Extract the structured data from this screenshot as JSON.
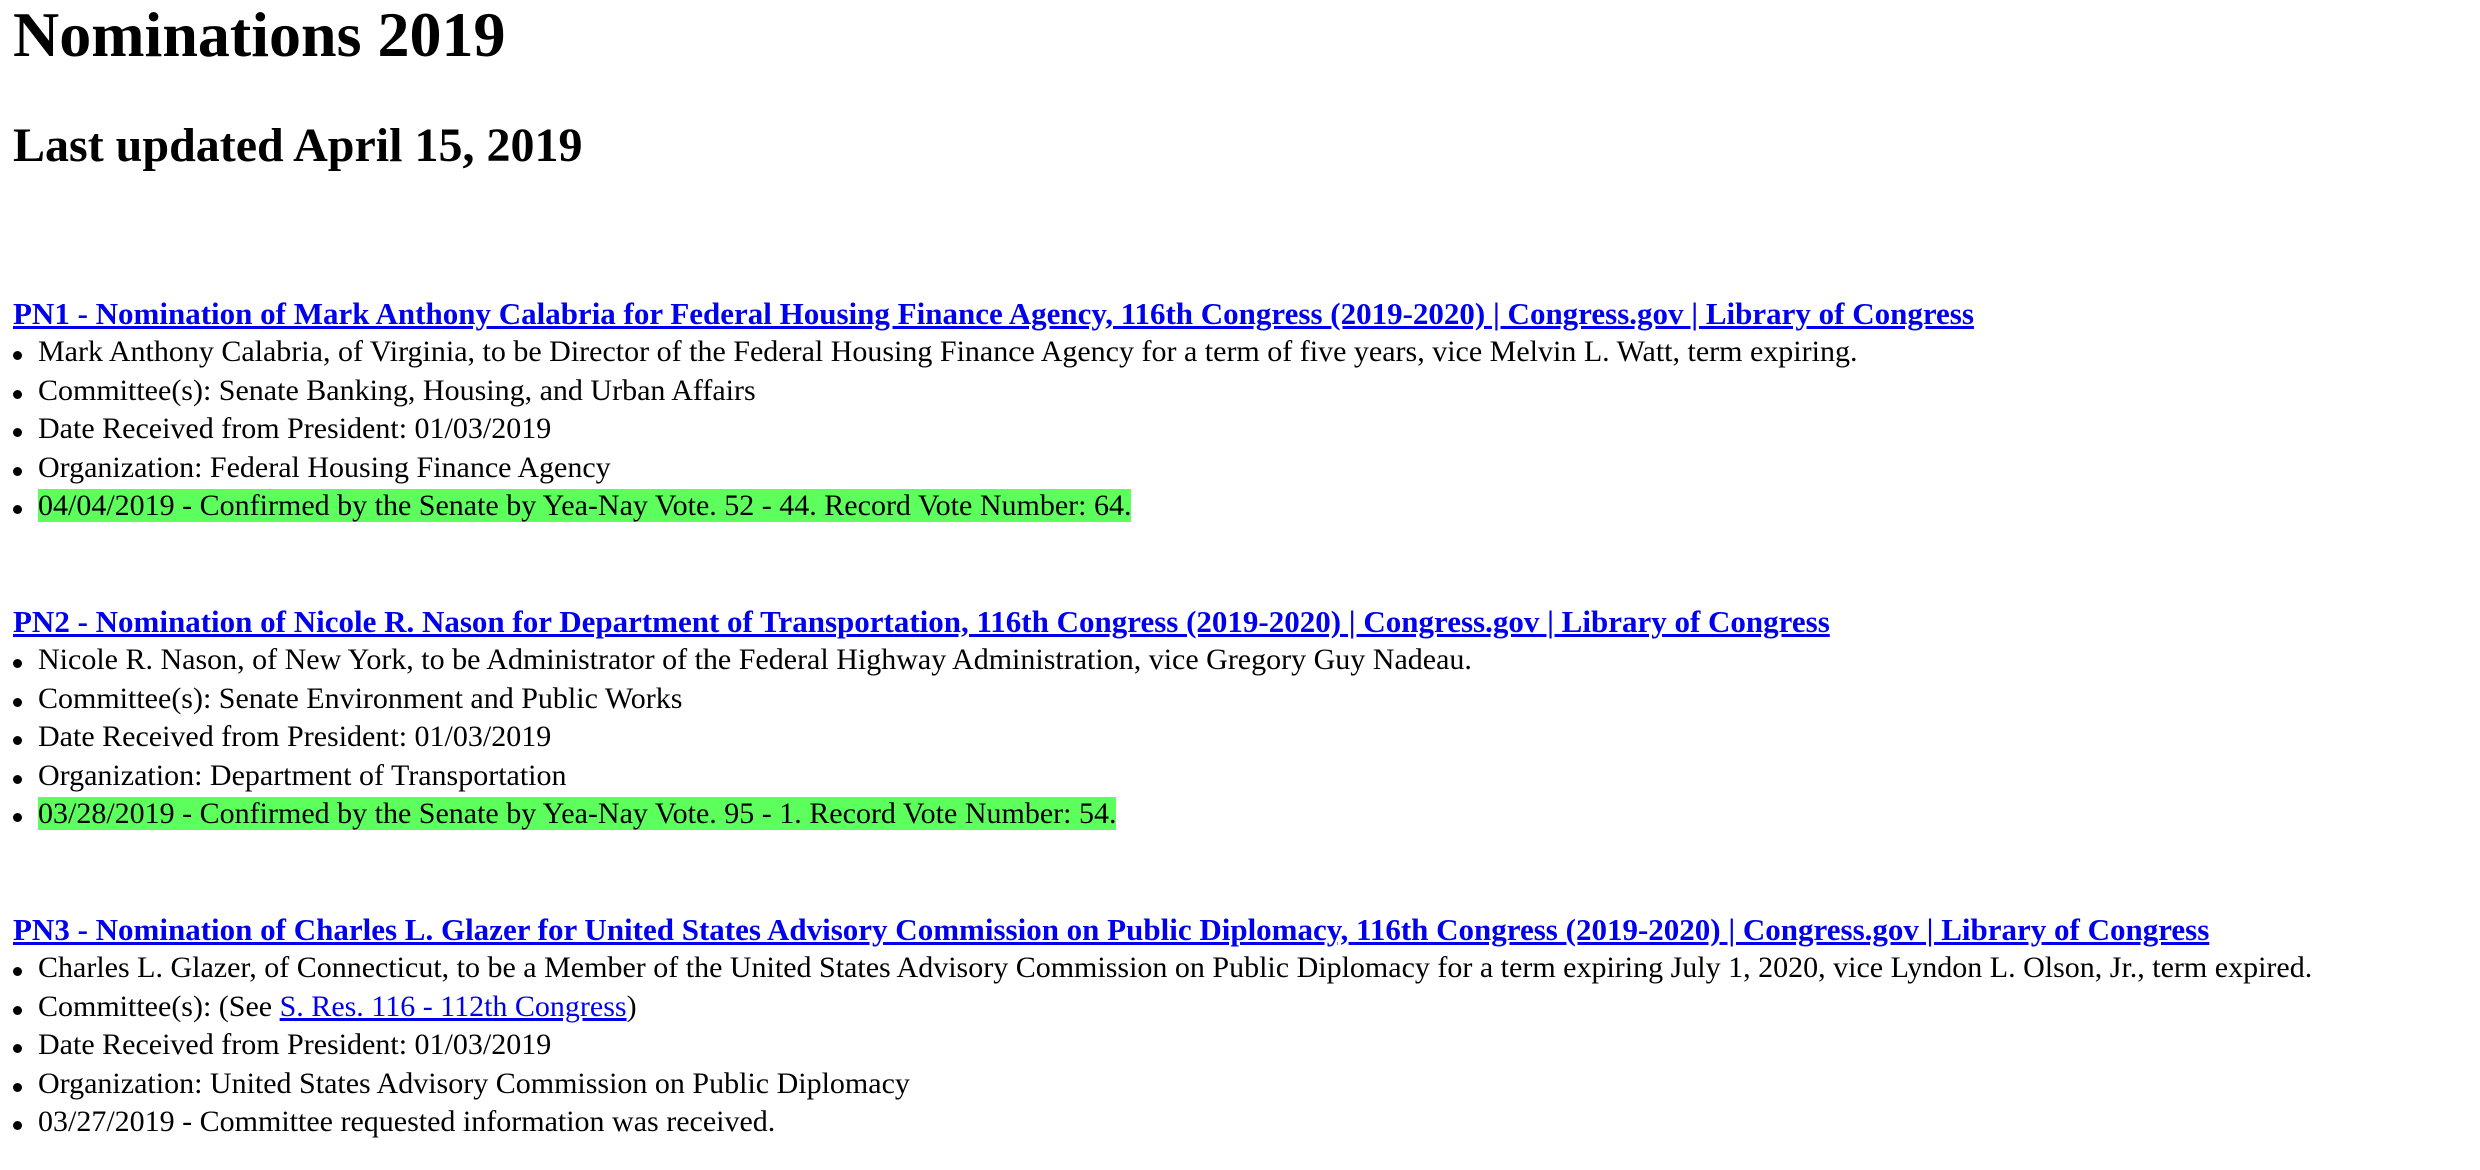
{
  "header": {
    "title": "Nominations 2019",
    "subtitle": "Last updated April 15, 2019"
  },
  "nominations": [
    {
      "title": "PN1 - Nomination of Mark Anthony Calabria for Federal Housing Finance Agency, 116th Congress (2019-2020) | Congress.gov | Library of Congress",
      "description": "Mark Anthony Calabria, of Virginia, to be Director of the Federal Housing Finance Agency for a term of five years, vice Melvin L. Watt, term expiring.",
      "committee": "Committee(s): Senate Banking, Housing, and Urban Affairs",
      "date_received": "Date Received from President: 01/03/2019",
      "organization": "Organization: Federal Housing Finance Agency",
      "latest_action": "04/04/2019 - Confirmed by the Senate by Yea-Nay Vote. 52 - 44. Record Vote Number: 64.",
      "highlighted": true
    },
    {
      "title": "PN2 - Nomination of Nicole R. Nason for Department of Transportation, 116th Congress (2019-2020) | Congress.gov | Library of Congress",
      "description": "Nicole R. Nason, of New York, to be Administrator of the Federal Highway Administration, vice Gregory Guy Nadeau.",
      "committee": "Committee(s): Senate Environment and Public Works",
      "date_received": "Date Received from President: 01/03/2019",
      "organization": "Organization: Department of Transportation",
      "latest_action": "03/28/2019 - Confirmed by the Senate by Yea-Nay Vote. 95 - 1. Record Vote Number: 54.",
      "highlighted": true
    },
    {
      "title": "PN3 - Nomination of Charles L. Glazer for United States Advisory Commission on Public Diplomacy, 116th Congress (2019-2020) | Congress.gov | Library of Congress",
      "description": "Charles L. Glazer, of Connecticut, to be a Member of the United States Advisory Commission on Public Diplomacy for a term expiring July 1, 2020, vice Lyndon L. Olson, Jr., term expired.",
      "committee_prefix": "Committee(s): (See ",
      "committee_link": "S. Res. 116 - 112th Congress",
      "committee_suffix": ")",
      "date_received": "Date Received from President: 01/03/2019",
      "organization": "Organization: United States Advisory Commission on Public Diplomacy",
      "latest_action": "03/27/2019 - Committee requested information was received.",
      "highlighted": false
    }
  ],
  "colors": {
    "link": "#0000ee",
    "highlight": "#5cff5c",
    "text": "#000000",
    "background": "#ffffff"
  }
}
